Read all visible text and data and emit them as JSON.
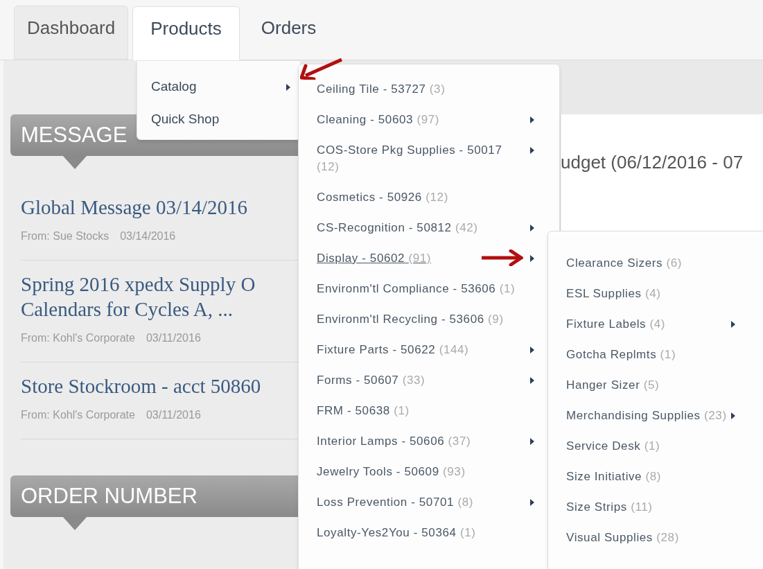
{
  "tabs": [
    {
      "label": "Dashboard",
      "selected": false
    },
    {
      "label": "Products",
      "selected": true
    },
    {
      "label": "Orders",
      "selected": false
    }
  ],
  "products_menu": [
    {
      "label": "Catalog",
      "has_submenu": true
    },
    {
      "label": "Quick Shop",
      "has_submenu": false
    }
  ],
  "catalog_menu": [
    {
      "name": "Ceiling Tile - 53727",
      "count": "(3)",
      "has_submenu": false,
      "selected": false
    },
    {
      "name": "Cleaning - 50603",
      "count": "(97)",
      "has_submenu": true,
      "selected": false
    },
    {
      "name": "COS-Store Pkg Supplies - 50017",
      "count": "(12)",
      "has_submenu": true,
      "selected": false
    },
    {
      "name": "Cosmetics - 50926",
      "count": "(12)",
      "has_submenu": false,
      "selected": false
    },
    {
      "name": "CS-Recognition - 50812",
      "count": "(42)",
      "has_submenu": true,
      "selected": false
    },
    {
      "name": "Display - 50602",
      "count": "(91)",
      "has_submenu": true,
      "selected": true
    },
    {
      "name": "Environm'tl Compliance - 53606",
      "count": "(1)",
      "has_submenu": false,
      "selected": false
    },
    {
      "name": "Environm'tl Recycling - 53606",
      "count": "(9)",
      "has_submenu": false,
      "selected": false
    },
    {
      "name": "Fixture Parts - 50622",
      "count": "(144)",
      "has_submenu": true,
      "selected": false
    },
    {
      "name": "Forms - 50607",
      "count": "(33)",
      "has_submenu": true,
      "selected": false
    },
    {
      "name": "FRM - 50638",
      "count": "(1)",
      "has_submenu": false,
      "selected": false
    },
    {
      "name": "Interior Lamps - 50606",
      "count": "(37)",
      "has_submenu": true,
      "selected": false
    },
    {
      "name": "Jewelry Tools - 50609",
      "count": "(93)",
      "has_submenu": false,
      "selected": false
    },
    {
      "name": "Loss Prevention - 50701",
      "count": "(8)",
      "has_submenu": true,
      "selected": false
    },
    {
      "name": "Loyalty-Yes2You - 50364",
      "count": "(1)",
      "has_submenu": false,
      "selected": false
    }
  ],
  "display_menu": [
    {
      "name": "Clearance Sizers",
      "count": "(6)",
      "has_submenu": false
    },
    {
      "name": "ESL Supplies",
      "count": "(4)",
      "has_submenu": false
    },
    {
      "name": "Fixture Labels",
      "count": "(4)",
      "has_submenu": true
    },
    {
      "name": "Gotcha Replmts",
      "count": "(1)",
      "has_submenu": false
    },
    {
      "name": "Hanger Sizer",
      "count": "(5)",
      "has_submenu": false
    },
    {
      "name": "Merchandising Supplies",
      "count": "(23)",
      "has_submenu": true
    },
    {
      "name": "Service Desk",
      "count": "(1)",
      "has_submenu": false
    },
    {
      "name": "Size Initiative",
      "count": "(8)",
      "has_submenu": false
    },
    {
      "name": "Size Strips",
      "count": "(11)",
      "has_submenu": false
    },
    {
      "name": "Visual Supplies",
      "count": "(28)",
      "has_submenu": false
    }
  ],
  "messages_header": "MESSAGE",
  "messages": [
    {
      "title": "Global Message 03/14/2016",
      "from": "From: Sue Stocks",
      "date": "03/14/2016"
    },
    {
      "title": "Spring 2016 xpedx Supply O Calendars for Cycles A, ...",
      "from": "From: Kohl's Corporate",
      "date": "03/11/2016"
    },
    {
      "title": "Store Stockroom - acct 50860",
      "from": "From: Kohl's Corporate",
      "date": "03/11/2016"
    }
  ],
  "order_header": "ORDER NUMBER",
  "budget_title": "udget (06/12/2016 - 07"
}
